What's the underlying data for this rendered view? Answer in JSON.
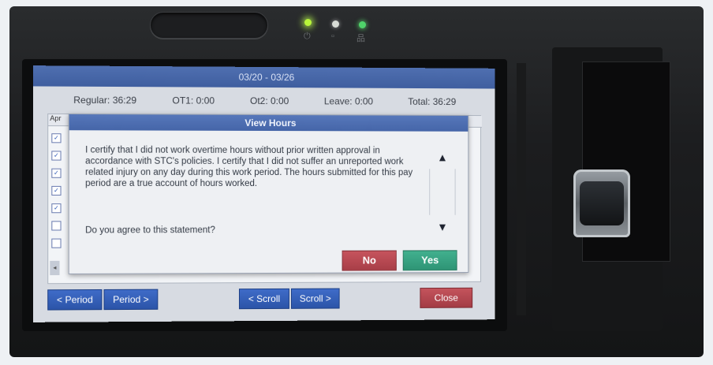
{
  "device": {
    "leds": [
      "power-led",
      "status-led",
      "network-led"
    ],
    "icons": {
      "power": "power-icon",
      "status": "status-icon",
      "network": "network-icon"
    }
  },
  "screen": {
    "title": "03/20 - 03/26",
    "totals": {
      "regular": "Regular: 36:29",
      "ot1": "OT1: 0:00",
      "ot2": "Ot2: 0:00",
      "leave": "Leave: 0:00",
      "total": "Total: 36:29"
    },
    "table_header": "Apr",
    "modal": {
      "title": "View Hours",
      "statement": "I certify that I did not work overtime hours without prior written approval in accordance with STC's policies. I certify that I did not suffer an unreported work related injury on any day during this work period. The hours submitted for this pay period are a true account of hours worked.",
      "question": "Do you agree to this statement?",
      "no_label": "No",
      "yes_label": "Yes",
      "scroll_up_icon": "triangle-up-icon",
      "scroll_down_icon": "triangle-down-icon"
    },
    "nav": {
      "prev_period": "< Period",
      "next_period": "Period >",
      "scroll_left": "< Scroll",
      "scroll_right": "Scroll >",
      "close": "Close"
    }
  },
  "colors": {
    "title_bar": "#4f6fb0",
    "no_button": "#b8484f",
    "yes_button": "#37a383",
    "nav_button": "#3461bd",
    "close_button": "#b5474f"
  }
}
